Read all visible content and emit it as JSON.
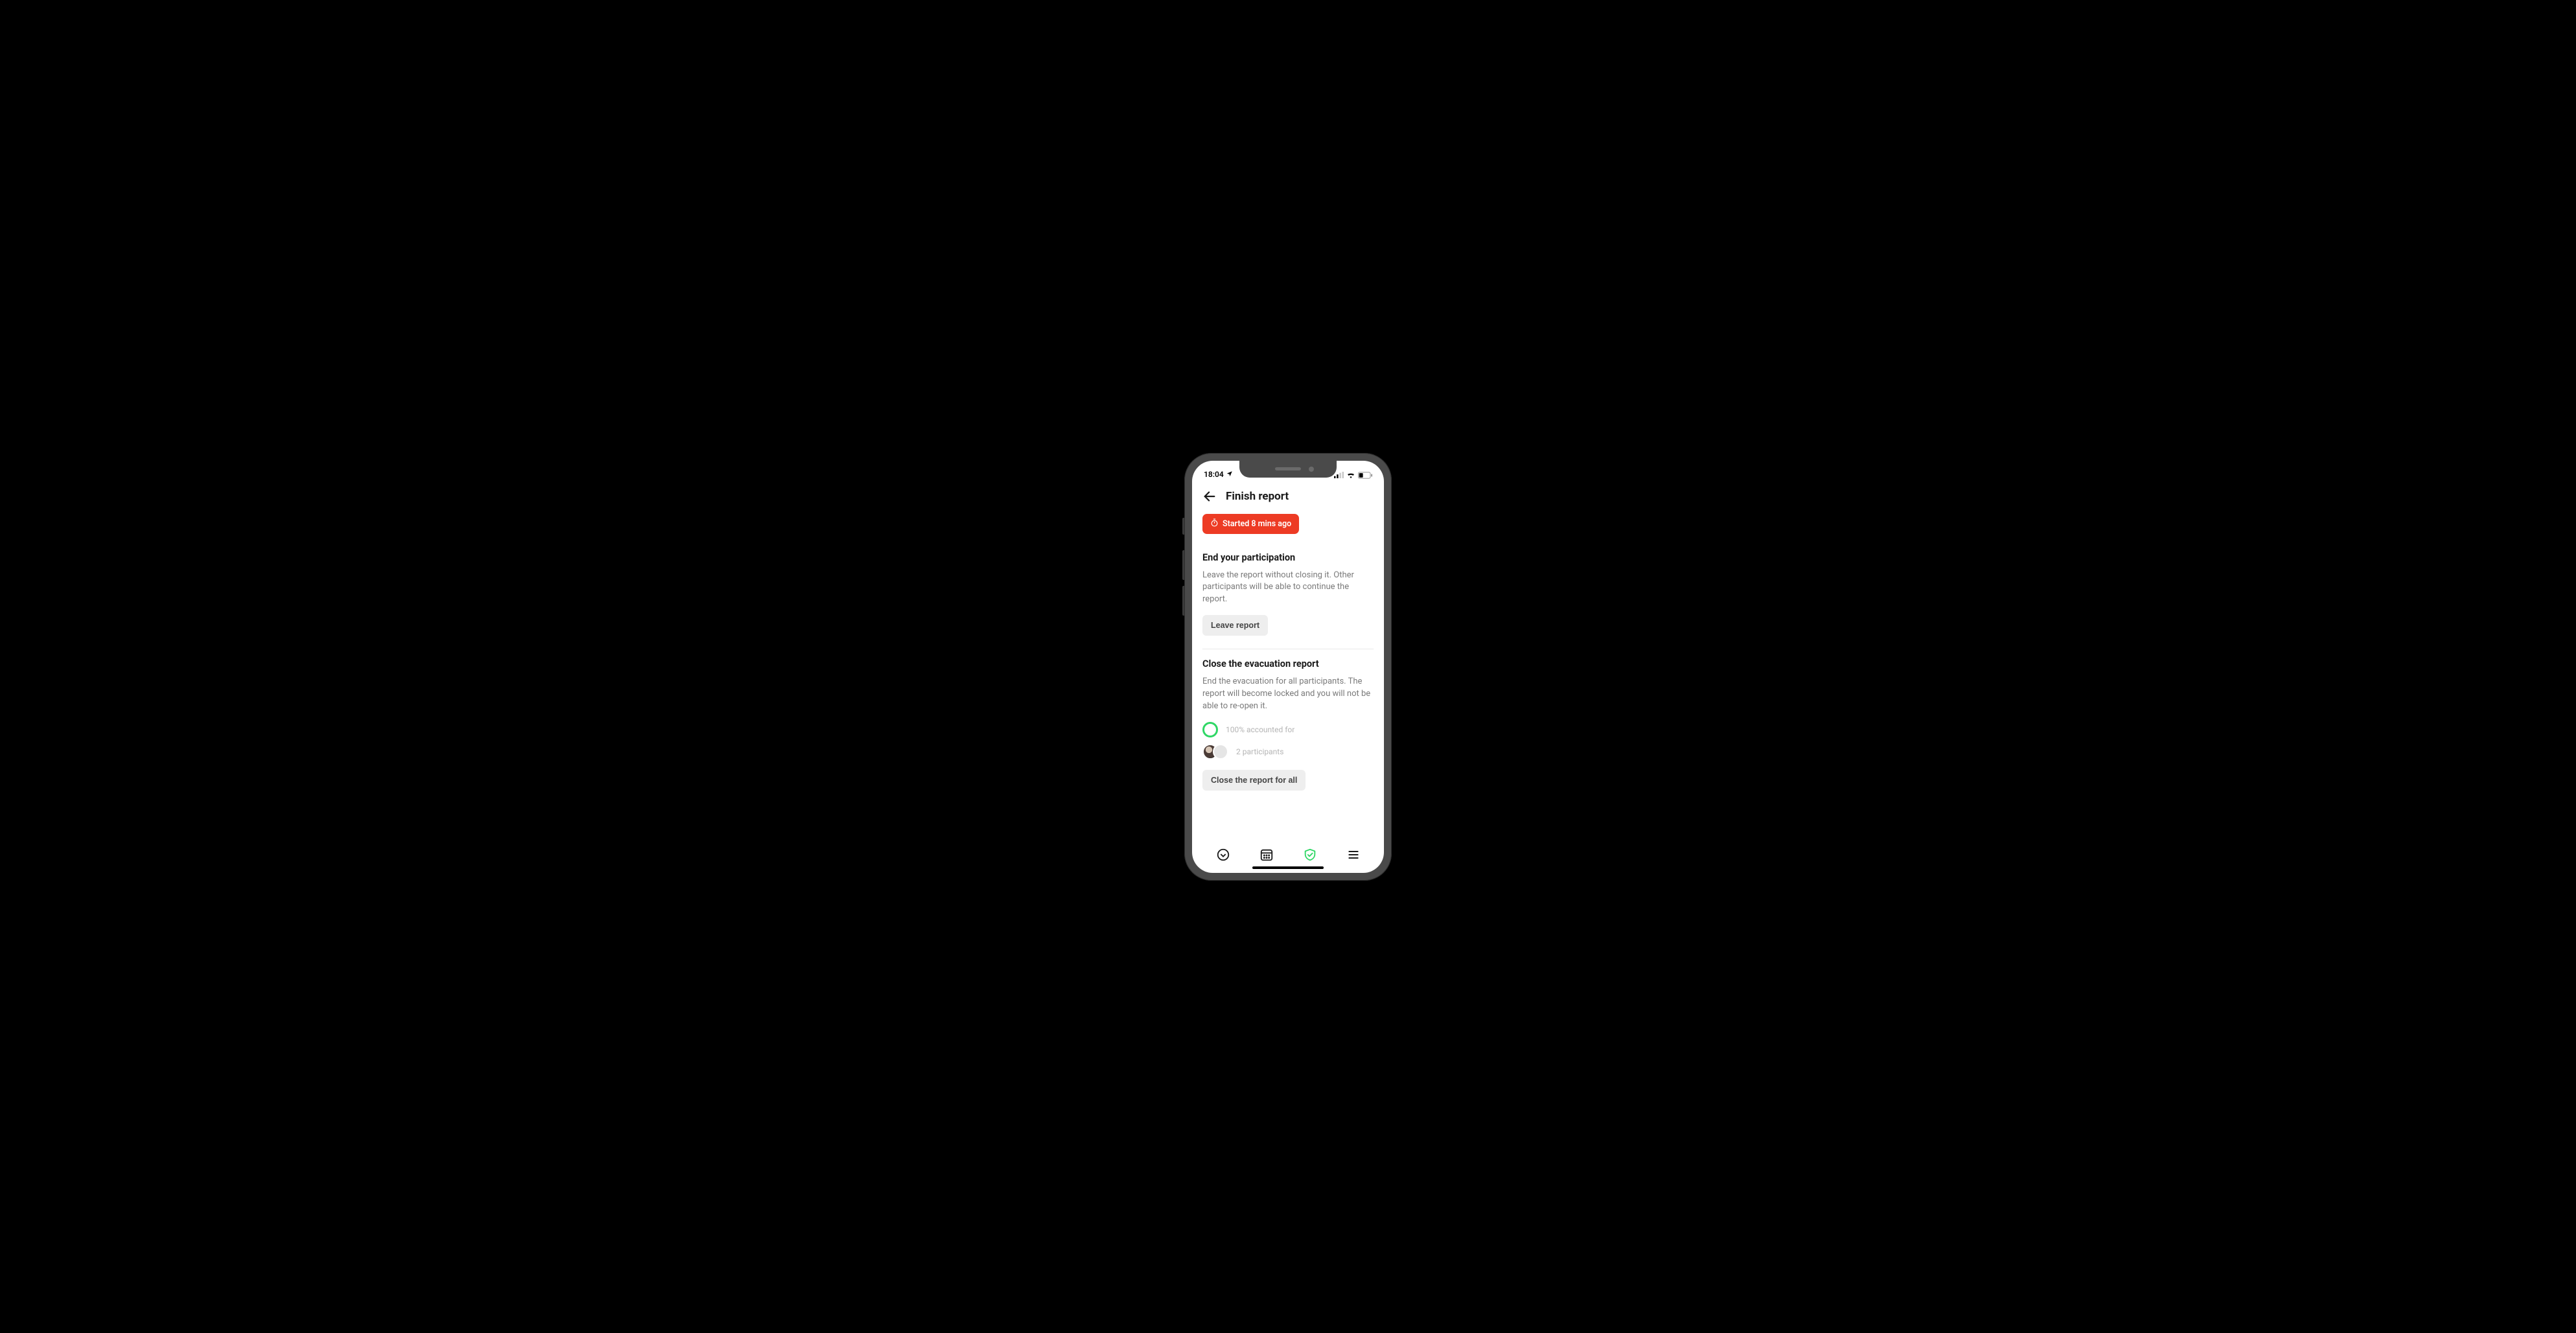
{
  "status_bar": {
    "time": "18:04"
  },
  "header": {
    "title": "Finish report"
  },
  "timer": {
    "label": "Started 8 mins ago"
  },
  "sections": {
    "end_participation": {
      "title": "End your participation",
      "body": "Leave the report without closing it. Other participants will be able to continue the report.",
      "button_label": "Leave report"
    },
    "close_report": {
      "title": "Close the evacuation report",
      "body": "End the evacuation for all participants. The report will become locked and you will not be able to re-open it.",
      "accounted_for_label": "100% accounted for",
      "participants_label": "2 participants",
      "button_label": "Close the report for all"
    }
  },
  "colors": {
    "accent_red": "#ed3b24",
    "accent_green": "#2fd765"
  }
}
